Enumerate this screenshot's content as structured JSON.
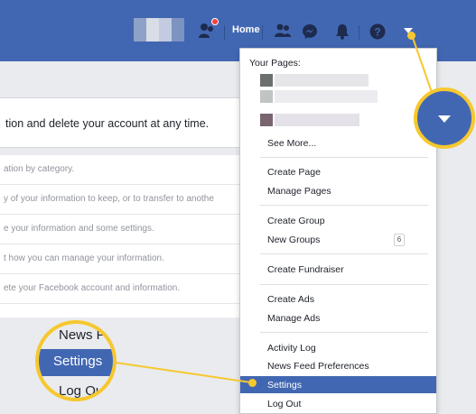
{
  "colors": {
    "brand": "#4267b2",
    "highlight": "#f6c82f",
    "notification": "#fa3e3e"
  },
  "topbar": {
    "home_label": "Home",
    "icons": [
      "find-friends-icon",
      "friend-requests-icon",
      "messenger-icon",
      "notifications-icon",
      "help-icon",
      "account-menu-caret-icon"
    ]
  },
  "content": {
    "intro": "tion and delete your account at any time.",
    "rows": [
      "ation by category.",
      "y of your information to keep, or to transfer to anothe",
      "e your information and some settings.",
      "t how you can manage your information.",
      "ete your Facebook account and information."
    ]
  },
  "menu": {
    "pages_heading": "Your Pages:",
    "see_more": "See More...",
    "create_page": "Create Page",
    "manage_pages": "Manage Pages",
    "create_group": "Create Group",
    "new_groups": "New Groups",
    "new_groups_count": "6",
    "create_fundraiser": "Create Fundraiser",
    "create_ads": "Create Ads",
    "manage_ads": "Manage Ads",
    "activity_log": "Activity Log",
    "news_feed_preferences": "News Feed Preferences",
    "settings": "Settings",
    "log_out": "Log Out"
  },
  "zoom": {
    "news_feed": "News Fe",
    "settings": "Settings",
    "log_out": "Log Out"
  }
}
